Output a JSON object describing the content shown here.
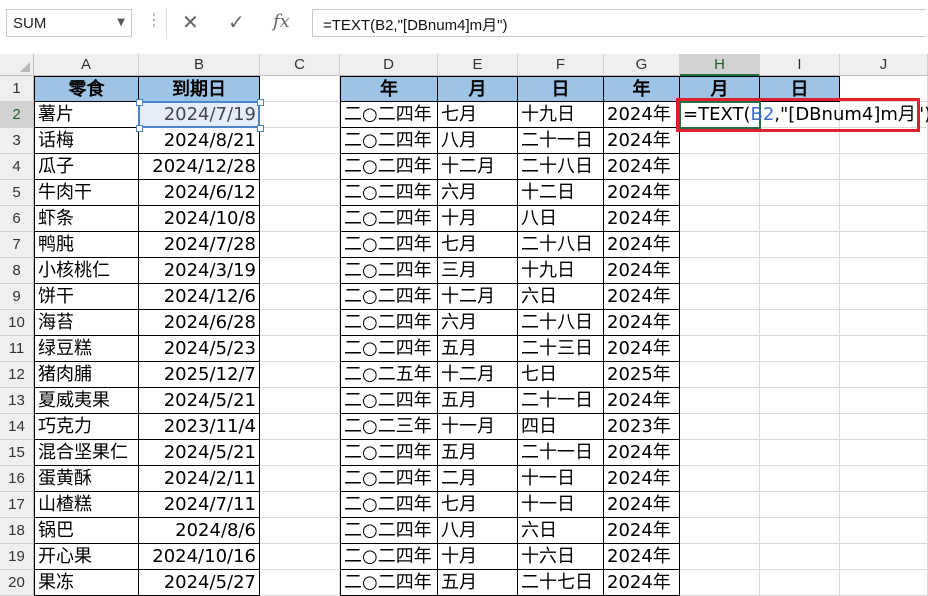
{
  "name_box": {
    "value": "SUM"
  },
  "formula_bar": {
    "formula": "=TEXT(B2,\"[DBnum4]m月\")",
    "cancel_icon": "close-icon",
    "enter_icon": "check-icon",
    "function_icon": "fx-icon"
  },
  "columns": [
    "A",
    "B",
    "C",
    "D",
    "E",
    "F",
    "G",
    "H",
    "I",
    "J"
  ],
  "header_row": {
    "A": "零食",
    "B": "到期日",
    "D": "年",
    "E": "月",
    "F": "日",
    "G": "年",
    "H": "月",
    "I": "日"
  },
  "active_cell": "H2",
  "editing": {
    "prefix": "=TEXT(",
    "ref": "B2",
    "suffix": ",\"[DBnum4]m月\")"
  },
  "rows": [
    {
      "n": "1"
    },
    {
      "n": "2",
      "a": "薯片",
      "b": "2024/7/19",
      "d": "二○二四年",
      "e": "七月",
      "f": "十九日",
      "g": "2024年"
    },
    {
      "n": "3",
      "a": "话梅",
      "b": "2024/8/21",
      "d": "二○二四年",
      "e": "八月",
      "f": "二十一日",
      "g": "2024年"
    },
    {
      "n": "4",
      "a": "瓜子",
      "b": "2024/12/28",
      "d": "二○二四年",
      "e": "十二月",
      "f": "二十八日",
      "g": "2024年"
    },
    {
      "n": "5",
      "a": "牛肉干",
      "b": "2024/6/12",
      "d": "二○二四年",
      "e": "六月",
      "f": "十二日",
      "g": "2024年"
    },
    {
      "n": "6",
      "a": "虾条",
      "b": "2024/10/8",
      "d": "二○二四年",
      "e": "十月",
      "f": "八日",
      "g": "2024年"
    },
    {
      "n": "7",
      "a": "鸭肫",
      "b": "2024/7/28",
      "d": "二○二四年",
      "e": "七月",
      "f": "二十八日",
      "g": "2024年"
    },
    {
      "n": "8",
      "a": "小核桃仁",
      "b": "2024/3/19",
      "d": "二○二四年",
      "e": "三月",
      "f": "十九日",
      "g": "2024年"
    },
    {
      "n": "9",
      "a": "饼干",
      "b": "2024/12/6",
      "d": "二○二四年",
      "e": "十二月",
      "f": "六日",
      "g": "2024年"
    },
    {
      "n": "10",
      "a": "海苔",
      "b": "2024/6/28",
      "d": "二○二四年",
      "e": "六月",
      "f": "二十八日",
      "g": "2024年"
    },
    {
      "n": "11",
      "a": "绿豆糕",
      "b": "2024/5/23",
      "d": "二○二四年",
      "e": "五月",
      "f": "二十三日",
      "g": "2024年"
    },
    {
      "n": "12",
      "a": "猪肉脯",
      "b": "2025/12/7",
      "d": "二○二五年",
      "e": "十二月",
      "f": "七日",
      "g": "2025年"
    },
    {
      "n": "13",
      "a": "夏威夷果",
      "b": "2024/5/21",
      "d": "二○二四年",
      "e": "五月",
      "f": "二十一日",
      "g": "2024年"
    },
    {
      "n": "14",
      "a": "巧克力",
      "b": "2023/11/4",
      "d": "二○二三年",
      "e": "十一月",
      "f": "四日",
      "g": "2023年"
    },
    {
      "n": "15",
      "a": "混合坚果仁",
      "b": "2024/5/21",
      "d": "二○二四年",
      "e": "五月",
      "f": "二十一日",
      "g": "2024年"
    },
    {
      "n": "16",
      "a": "蛋黄酥",
      "b": "2024/2/11",
      "d": "二○二四年",
      "e": "二月",
      "f": "十一日",
      "g": "2024年"
    },
    {
      "n": "17",
      "a": "山楂糕",
      "b": "2024/7/11",
      "d": "二○二四年",
      "e": "七月",
      "f": "十一日",
      "g": "2024年"
    },
    {
      "n": "18",
      "a": "锅巴",
      "b": "2024/8/6",
      "d": "二○二四年",
      "e": "八月",
      "f": "六日",
      "g": "2024年"
    },
    {
      "n": "19",
      "a": "开心果",
      "b": "2024/10/16",
      "d": "二○二四年",
      "e": "十月",
      "f": "十六日",
      "g": "2024年"
    },
    {
      "n": "20",
      "a": "果冻",
      "b": "2024/5/27",
      "d": "二○二四年",
      "e": "五月",
      "f": "二十七日",
      "g": "2024年"
    }
  ],
  "colors": {
    "header_fill": "#9dc3e6",
    "highlight_box": "#e0202a",
    "active_border": "#217346"
  }
}
